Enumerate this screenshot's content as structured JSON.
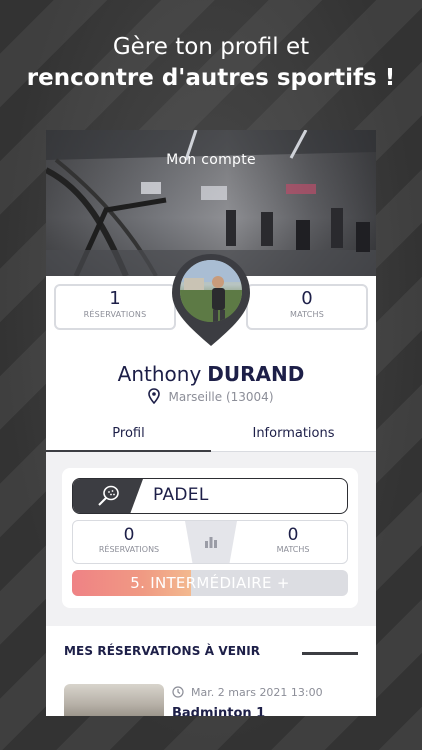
{
  "promo": {
    "line1": "Gère ton profil et",
    "line2": "rencontre d'autres sportifs !"
  },
  "header": {
    "title": "Mon compte"
  },
  "profile": {
    "reservations_count": "1",
    "reservations_label": "RÉSERVATIONS",
    "matchs_count": "0",
    "matchs_label": "MATCHS",
    "first_name": "Anthony",
    "last_name": "DURAND",
    "location": "Marseille (13004)"
  },
  "tabs": [
    {
      "label": "Profil",
      "active": true
    },
    {
      "label": "Informations",
      "active": false
    }
  ],
  "sport": {
    "name": "PADEL",
    "icon": "padel-racket-icon",
    "reservations_count": "0",
    "reservations_label": "RÉSERVATIONS",
    "matchs_count": "0",
    "matchs_label": "MATCHS",
    "level_label": "5. INTERMÉDIAIRE +",
    "level_progress_percent": 43
  },
  "reservations": {
    "section_title": "MES RÉSERVATIONS À VENIR",
    "items": [
      {
        "date": "Mar. 2 mars 2021 13:00",
        "name": "Badminton 1"
      }
    ]
  },
  "colors": {
    "navy": "#1d1f48",
    "dark": "#3c3d42",
    "level_gradient_start": "#ef8285",
    "level_gradient_end": "#f3b98f"
  }
}
